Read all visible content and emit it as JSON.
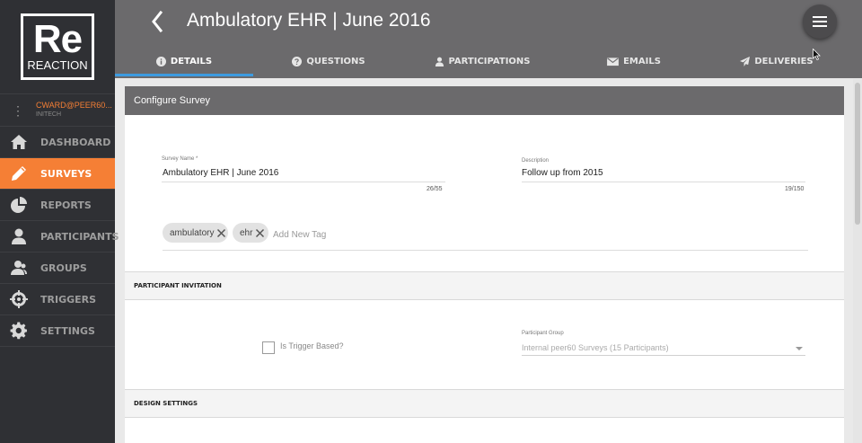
{
  "sidebar": {
    "logo": {
      "line1": "Re",
      "line2": "REACTION"
    },
    "user": {
      "email": "CWARD@PEER60...",
      "org": "INITECH"
    },
    "items": [
      {
        "label": "DASHBOARD",
        "icon": "home-icon"
      },
      {
        "label": "SURVEYS",
        "icon": "pencil-icon",
        "active": true
      },
      {
        "label": "REPORTS",
        "icon": "pie-chart-icon"
      },
      {
        "label": "PARTICIPANTS",
        "icon": "user-icon"
      },
      {
        "label": "GROUPS",
        "icon": "group-icon"
      },
      {
        "label": "TRIGGERS",
        "icon": "crosshair-icon"
      },
      {
        "label": "SETTINGS",
        "icon": "gear-icon"
      }
    ]
  },
  "header": {
    "title": "Ambulatory EHR | June 2016",
    "tabs": [
      {
        "label": "DETAILS",
        "icon": "info-icon",
        "active": true
      },
      {
        "label": "QUESTIONS",
        "icon": "question-icon"
      },
      {
        "label": "PARTICIPATIONS",
        "icon": "user-icon"
      },
      {
        "label": "EMAILS",
        "icon": "envelope-icon"
      },
      {
        "label": "DELIVERIES",
        "icon": "paper-plane-icon"
      }
    ]
  },
  "card": {
    "title": "Configure Survey",
    "survey_name": {
      "label": "Survey Name *",
      "value": "Ambulatory EHR | June 2016",
      "counter": "26/55"
    },
    "description": {
      "label": "Description",
      "value": "Follow up from 2015",
      "counter": "19/150"
    },
    "tags": [
      "ambulatory",
      "ehr"
    ],
    "tag_placeholder": "Add New Tag",
    "participant_invitation": {
      "title": "PARTICIPANT INVITATION",
      "trigger_label": "Is Trigger Based?",
      "group_label": "Participant Group",
      "group_value": "Internal peer60 Surveys (15 Participants)"
    },
    "design_settings": {
      "title": "DESIGN SETTINGS"
    }
  },
  "colors": {
    "accent": "#f57f35",
    "sidebar": "#2f3034",
    "header": "#6b6a6c",
    "tab_underline": "#3d9be0"
  }
}
